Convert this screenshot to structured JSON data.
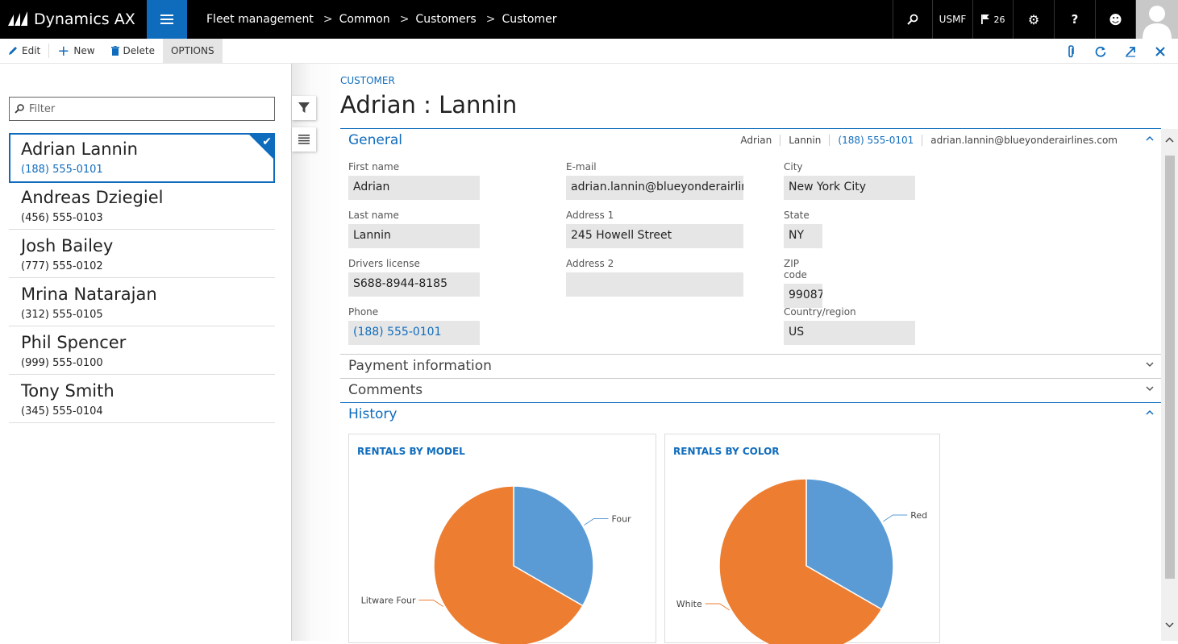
{
  "app": {
    "name": "Dynamics AX"
  },
  "breadcrumb": [
    "Fleet management",
    "Common",
    "Customers",
    "Customer"
  ],
  "topbar": {
    "company": "USMF",
    "notifications": "26"
  },
  "actions": {
    "edit": "Edit",
    "new": "New",
    "delete": "Delete",
    "options": "OPTIONS"
  },
  "filter": {
    "placeholder": "Filter"
  },
  "customers": [
    {
      "name": "Adrian Lannin",
      "phone": "(188) 555-0101",
      "selected": true
    },
    {
      "name": "Andreas Dziegiel",
      "phone": "(456) 555-0103"
    },
    {
      "name": "Josh Bailey",
      "phone": "(777) 555-0102"
    },
    {
      "name": "Mrina Natarajan",
      "phone": "(312) 555-0105"
    },
    {
      "name": "Phil Spencer",
      "phone": "(999) 555-0100"
    },
    {
      "name": "Tony Smith",
      "phone": "(345) 555-0104"
    }
  ],
  "record": {
    "caption": "CUSTOMER",
    "title": "Adrian : Lannin"
  },
  "general": {
    "title": "General",
    "summary": {
      "first": "Adrian",
      "last": "Lannin",
      "phone": "(188) 555-0101",
      "email": "adrian.lannin@blueyonderairlines.com"
    },
    "fields": {
      "first_name": {
        "label": "First name",
        "value": "Adrian"
      },
      "last_name": {
        "label": "Last name",
        "value": "Lannin"
      },
      "license": {
        "label": "Drivers license",
        "value": "S688-8944-8185"
      },
      "phone": {
        "label": "Phone",
        "value": "(188) 555-0101"
      },
      "email": {
        "label": "E-mail",
        "value": "adrian.lannin@blueyonderairlines."
      },
      "address1": {
        "label": "Address 1",
        "value": "245 Howell Street"
      },
      "address2": {
        "label": "Address 2",
        "value": ""
      },
      "city": {
        "label": "City",
        "value": "New York City"
      },
      "state": {
        "label": "State",
        "value": "NY"
      },
      "zip": {
        "label": "ZIP code",
        "value": "99087"
      },
      "country": {
        "label": "Country/region",
        "value": "US"
      }
    }
  },
  "sections": {
    "payment": "Payment information",
    "comments": "Comments",
    "history": "History"
  },
  "colors": {
    "accent": "#0f6cbd",
    "slice_blue": "#5b9bd5",
    "slice_orange": "#ed7d31"
  },
  "chart_data": [
    {
      "type": "pie",
      "title": "RENTALS BY MODEL",
      "categories": [
        "Four",
        "Litware Four"
      ],
      "values": [
        1,
        2
      ]
    },
    {
      "type": "pie",
      "title": "RENTALS BY COLOR",
      "categories": [
        "Red",
        "White"
      ],
      "values": [
        1,
        2
      ]
    }
  ]
}
